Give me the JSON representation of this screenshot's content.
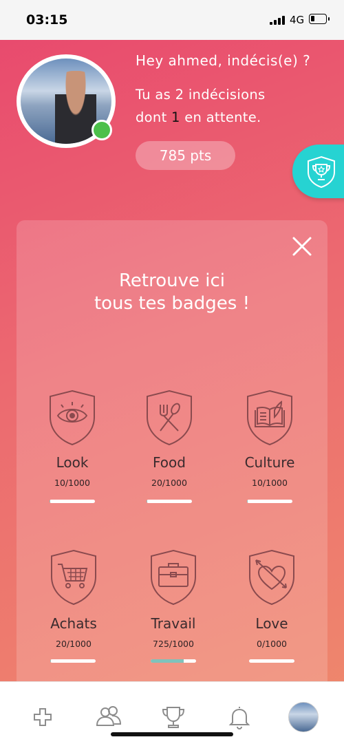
{
  "status_bar": {
    "time": "03:15",
    "network": "4G",
    "signal_bars": 4,
    "battery_level": 0.25
  },
  "profile": {
    "greeting": "Hey ahmed, indécis(e) ?",
    "summary_line1": "Tu as 2 indécisions",
    "summary_line2_prefix": "dont ",
    "pending_count": "1",
    "summary_line2_suffix": " en attente.",
    "points": "785 pts",
    "online": true
  },
  "trophy_tab": {
    "icon": "trophy-icon"
  },
  "badges_panel": {
    "title_line1": "Retrouve ici",
    "title_line2": "tous tes badges !",
    "close_icon": "close-icon",
    "badges": [
      {
        "name": "Look",
        "score": "10/1000",
        "progress": 0.01,
        "icon": "eye-icon"
      },
      {
        "name": "Food",
        "score": "20/1000",
        "progress": 0.02,
        "icon": "fork-spoon-icon"
      },
      {
        "name": "Culture",
        "score": "10/1000",
        "progress": 0.01,
        "icon": "book-icon"
      },
      {
        "name": "Achats",
        "score": "20/1000",
        "progress": 0.02,
        "icon": "cart-icon"
      },
      {
        "name": "Travail",
        "score": "725/1000",
        "progress": 0.725,
        "icon": "briefcase-icon"
      },
      {
        "name": "Love",
        "score": "0/1000",
        "progress": 0.0,
        "icon": "heart-arrow-icon"
      }
    ]
  },
  "tab_bar": {
    "items": [
      {
        "icon": "plus-icon"
      },
      {
        "icon": "friends-icon"
      },
      {
        "icon": "trophy-icon"
      },
      {
        "icon": "bell-icon"
      },
      {
        "icon": "profile-avatar"
      }
    ]
  },
  "colors": {
    "accent_teal": "#26d3d2",
    "online_green": "#4cc04a",
    "progress_fill": "#7fc2bb",
    "badge_stroke": "#8a4a4e"
  }
}
